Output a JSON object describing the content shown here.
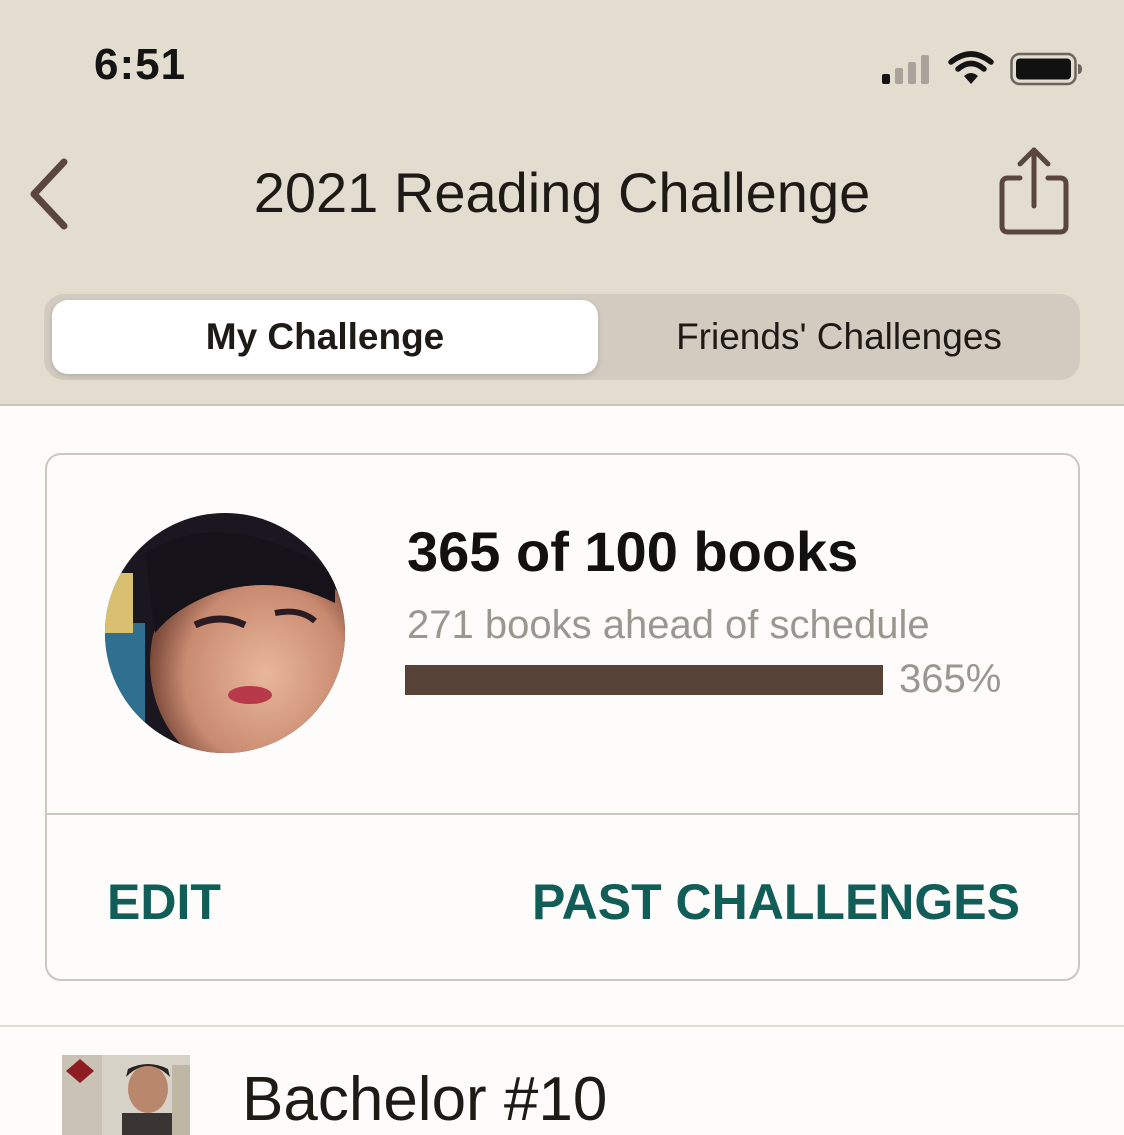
{
  "status_bar": {
    "time": "6:51"
  },
  "nav": {
    "title": "2021 Reading Challenge",
    "back_icon": "chevron-left-icon",
    "share_icon": "share-icon"
  },
  "segments": {
    "selected": "My Challenge",
    "other": "Friends' Challenges"
  },
  "challenge": {
    "count_text": "365 of 100 books",
    "ahead_text": "271 books ahead of schedule",
    "progress_percent": 365,
    "progress_label": "365%",
    "edit_label": "EDIT",
    "past_label": "PAST CHALLENGES"
  },
  "books": [
    {
      "title": "Bachelor #10"
    }
  ],
  "colors": {
    "header_bg": "#e2ddcf",
    "progress_fill": "#574238",
    "accent": "#115d57"
  }
}
